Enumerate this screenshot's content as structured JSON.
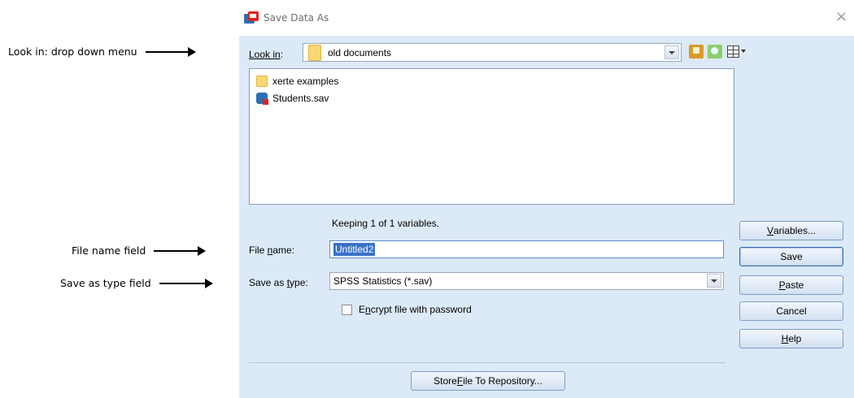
{
  "annotations": {
    "look_in": "Look in: drop down menu",
    "file_name": "File name field",
    "save_type": "Save as type field"
  },
  "dialog": {
    "title": "Save Data As",
    "close": "×",
    "look_in": {
      "label": "Look in:",
      "value": "old documents"
    },
    "toolbar_icons": [
      "up-folder-icon",
      "new-folder-icon",
      "view-menu-icon"
    ],
    "files": [
      {
        "name": "xerte examples",
        "icon": "folder-icon"
      },
      {
        "name": "Students.sav",
        "icon": "spss-file-icon"
      }
    ],
    "keeping": "Keeping 1 of 1 variables.",
    "file_name": {
      "label": "File name:",
      "value": "Untitled2"
    },
    "save_type": {
      "label": "Save as type:",
      "value": "SPSS Statistics (*.sav)"
    },
    "encrypt": {
      "label": "Encrypt file with password",
      "checked": false
    },
    "buttons": {
      "variables": "Variables...",
      "save": "Save",
      "paste": "Paste",
      "cancel": "Cancel",
      "help": "Help",
      "store": "Store File To Repository..."
    }
  }
}
